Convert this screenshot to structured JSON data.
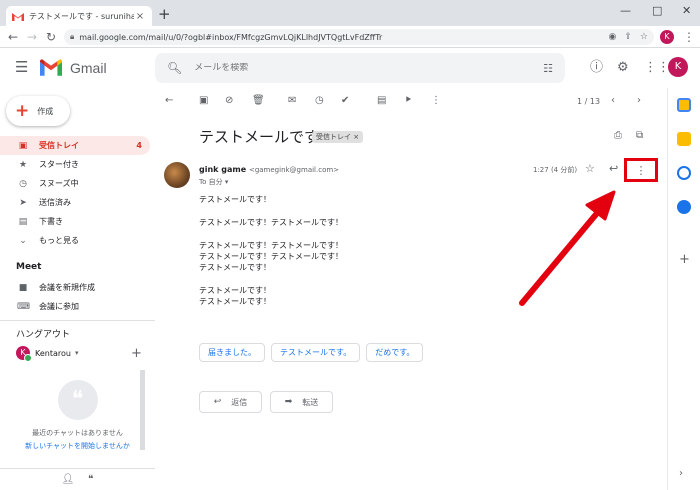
{
  "browser": {
    "tab_title": "テストメールです - surunihacom@gmail.com",
    "tab_close": "×",
    "new_tab": "+",
    "window_minimize": "—",
    "window_maximize": "□",
    "window_close": "✕",
    "url": "mail.google.com/mail/u/0/?ogbl#inbox/FMfcgzGmvLQjKLlhdJVTQgtLvFdZffTr",
    "profile_initial": "K"
  },
  "gmail": {
    "app_name": "Gmail",
    "search_placeholder": "メールを検索",
    "avatar_initial": "K"
  },
  "sidebar": {
    "compose_label": "作成",
    "items": [
      {
        "label": "受信トレイ",
        "count": "4"
      },
      {
        "label": "スター付き"
      },
      {
        "label": "スヌーズ中"
      },
      {
        "label": "送信済み"
      },
      {
        "label": "下書き"
      },
      {
        "label": "もっと見る"
      }
    ],
    "meet_title": "Meet",
    "meet_items": [
      {
        "label": "会議を新規作成"
      },
      {
        "label": "会議に参加"
      }
    ],
    "hangouts_title": "ハングアウト",
    "hangouts_user": "Kentarou",
    "hangouts_user_initial": "K",
    "no_chats_text": "最近のチャットはありません",
    "start_chat_link": "新しいチャットを開始しませんか"
  },
  "mail": {
    "pager": "1 / 13",
    "subject": "テストメールです",
    "label_chip": "受信トレイ ×",
    "sender_name": "gink game",
    "sender_email": "<gamegink@gmail.com>",
    "to_line": "To 自分 ▾",
    "time": "1:27 (4 分前)",
    "body": [
      "テストメールです！",
      "",
      "テストメールです！テストメールです！",
      "",
      "テストメールです！テストメールです！",
      "テストメールです！テストメールです！",
      "テストメールです！",
      "",
      "テストメールです！",
      "テストメールです！"
    ],
    "smart_replies": [
      "届きました。",
      "テストメールです。",
      "だめです。"
    ],
    "reply_label": "返信",
    "forward_label": "転送"
  },
  "annotation": {
    "highlight_color": "#e3000f",
    "arrow_color": "#e3000f"
  }
}
